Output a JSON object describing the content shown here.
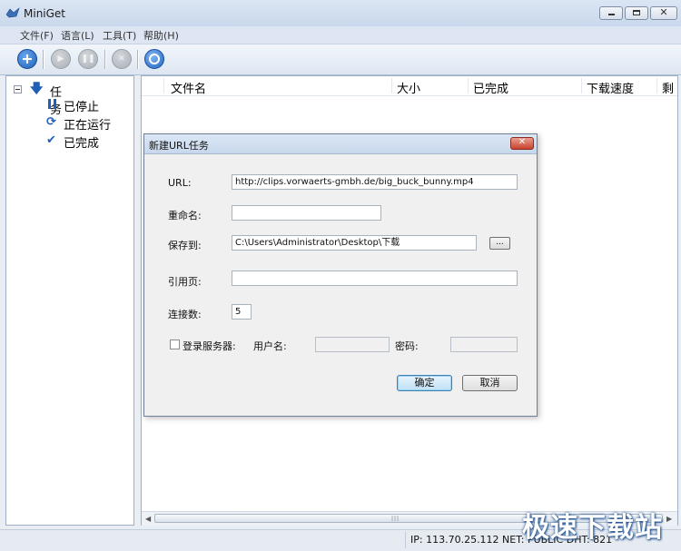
{
  "window": {
    "title": "MiniGet"
  },
  "menu": {
    "items": [
      "文件(F)",
      "语言(L)",
      "工具(T)",
      "帮助(H)"
    ]
  },
  "toolbar": {
    "buttons": [
      "add-icon",
      "play-icon",
      "pause-icon",
      "stop-icon",
      "settings-icon"
    ]
  },
  "tree": {
    "root": "任务",
    "items": [
      "已停止",
      "正在运行",
      "已完成"
    ]
  },
  "list": {
    "columns": [
      "文件名",
      "大小",
      "已完成",
      "下载速度",
      "剩"
    ]
  },
  "dialog": {
    "title": "新建URL任务",
    "url_label": "URL:",
    "url_value": "http://clips.vorwaerts-gmbh.de/big_buck_bunny.mp4",
    "rename_label": "重命名:",
    "rename_value": "",
    "save_label": "保存到:",
    "save_value": "C:\\Users\\Administrator\\Desktop\\下载",
    "browse_label": "...",
    "referer_label": "引用页:",
    "referer_value": "",
    "connections_label": "连接数:",
    "connections_value": "5",
    "login_label": "登录服务器:",
    "username_label": "用户名:",
    "password_label": "密码:",
    "ok_label": "确定",
    "cancel_label": "取消"
  },
  "status": {
    "text": "IP: 113.70.25.112  NET: PUBLIC   DHT: 821"
  },
  "watermark": "极速下载站"
}
